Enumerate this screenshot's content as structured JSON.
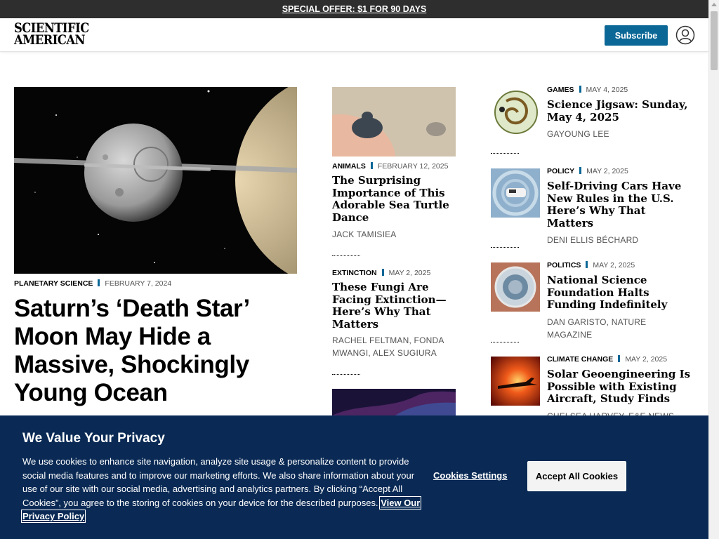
{
  "promo": {
    "text": "SPECIAL OFFER: $1 FOR 90 DAYS"
  },
  "header": {
    "logo_line1": "SCIENTIFIC",
    "logo_line2": "AMERICAN",
    "subscribe_label": "Subscribe"
  },
  "hero": {
    "category": "PLANETARY SCIENCE",
    "date": "FEBRUARY 7, 2024",
    "title": "Saturn’s ‘Death Star’ Moon May Hide a Massive, Shockingly Young Ocean"
  },
  "middle": [
    {
      "category": "ANIMALS",
      "date": "FEBRUARY 12, 2025",
      "title": "The Surprising Importance of This Adorable Sea Turtle Dance",
      "byline": "JACK TAMISIEA"
    },
    {
      "category": "EXTINCTION",
      "date": "MAY 2, 2025",
      "title": "These Fungi Are Facing Extinction—Here’s Why That Matters",
      "byline": "RACHEL FELTMAN, FONDA MWANGI, ALEX SUGIURA"
    }
  ],
  "right": [
    {
      "category": "GAMES",
      "date": "MAY 4, 2025",
      "title": "Science Jigsaw: Sunday, May 4, 2025",
      "byline": "GAYOUNG LEE"
    },
    {
      "category": "POLICY",
      "date": "MAY 2, 2025",
      "title": "Self-Driving Cars Have New Rules in the U.S. Here’s Why That Matters",
      "byline": "DENI ELLIS BÉCHARD"
    },
    {
      "category": "POLITICS",
      "date": "MAY 2, 2025",
      "title": "National Science Foundation Halts Funding Indefinitely",
      "byline": "DAN GARISTO, NATURE MAGAZINE"
    },
    {
      "category": "CLIMATE CHANGE",
      "date": "MAY 2, 2025",
      "title": "Solar Geoengineering Is Possible with Existing Aircraft, Study Finds",
      "byline": "CHELSEA HARVEY, E&E NEWS"
    }
  ],
  "cookie": {
    "title": "We Value Your Privacy",
    "text": "We use cookies to enhance site navigation, analyze site usage & personalize content to provide social media features and to improve our marketing efforts. We also share information about your use of our site with our social media, advertising and analytics partners. By clicking “Accept All Cookies”, you agree to the storing of cookies on your device for the described purposes.",
    "link_label": "View Our Privacy Policy",
    "settings_label": "Cookies Settings",
    "accept_label": "Accept All Cookies"
  },
  "colors": {
    "accent": "#0b6796",
    "banner": "#0a2a55",
    "promo_bg": "#2e2e2e"
  }
}
